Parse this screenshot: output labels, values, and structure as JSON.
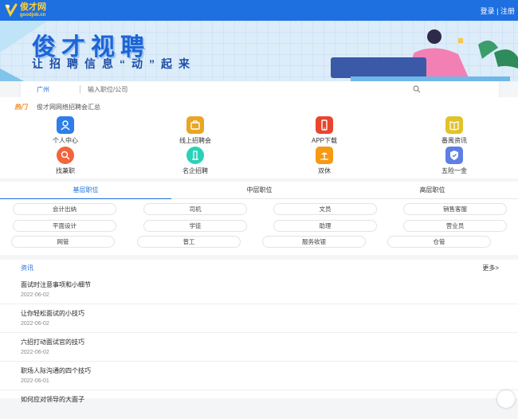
{
  "header": {
    "logo_cn": "俊才网",
    "logo_en": "goodjob.cn",
    "login": "登录",
    "divider": "|",
    "register": "注册",
    "brand_color": "#1e6fe0"
  },
  "banner": {
    "title": "俊才视聘",
    "subtitle": "让招聘信息“动”起来"
  },
  "search": {
    "city": "广州",
    "placeholder": "输入职位/公司",
    "icon": "search-icon"
  },
  "notice": {
    "tag": "热门",
    "text": "俊才网网络招聘会汇总"
  },
  "quick_links": [
    {
      "label": "个人中心",
      "icon": "user-icon",
      "color": "#2f7de8"
    },
    {
      "label": "线上招聘会",
      "icon": "briefcase-icon",
      "color": "#e9a623"
    },
    {
      "label": "APP下载",
      "icon": "phone-icon",
      "color": "#e8452d"
    },
    {
      "label": "番禺资讯",
      "icon": "book-icon",
      "color": "#e2c229"
    },
    {
      "label": "找兼职",
      "icon": "search-person-icon",
      "color": "#f2643c"
    },
    {
      "label": "名企招聘",
      "icon": "building-icon",
      "color": "#29d2b6"
    },
    {
      "label": "双休",
      "icon": "beach-icon",
      "color": "#f59a12"
    },
    {
      "label": "五险一金",
      "icon": "shield-icon",
      "color": "#5f7ee6"
    }
  ],
  "job_tabs": [
    {
      "label": "基层职位",
      "active": true
    },
    {
      "label": "中层职位",
      "active": false
    },
    {
      "label": "高层职位",
      "active": false
    }
  ],
  "job_tags": [
    "会计出纳",
    "司机",
    "文员",
    "销售客服",
    "平面设计",
    "学徒",
    "助理",
    "营业员",
    "网管",
    "普工",
    "服务收银",
    "仓管"
  ],
  "news": {
    "title": "资讯",
    "more": "更多>",
    "items": [
      {
        "title": "面试时注意事项和小细节",
        "date": "2022-06-02"
      },
      {
        "title": "让你轻松面试的小技巧",
        "date": "2022-06-02"
      },
      {
        "title": "六招打动面试官的技巧",
        "date": "2022-06-02"
      },
      {
        "title": "职场人际沟通的四个技巧",
        "date": "2022-06-01"
      },
      {
        "title": "如何应对领导的大面子",
        "date": ""
      }
    ]
  }
}
